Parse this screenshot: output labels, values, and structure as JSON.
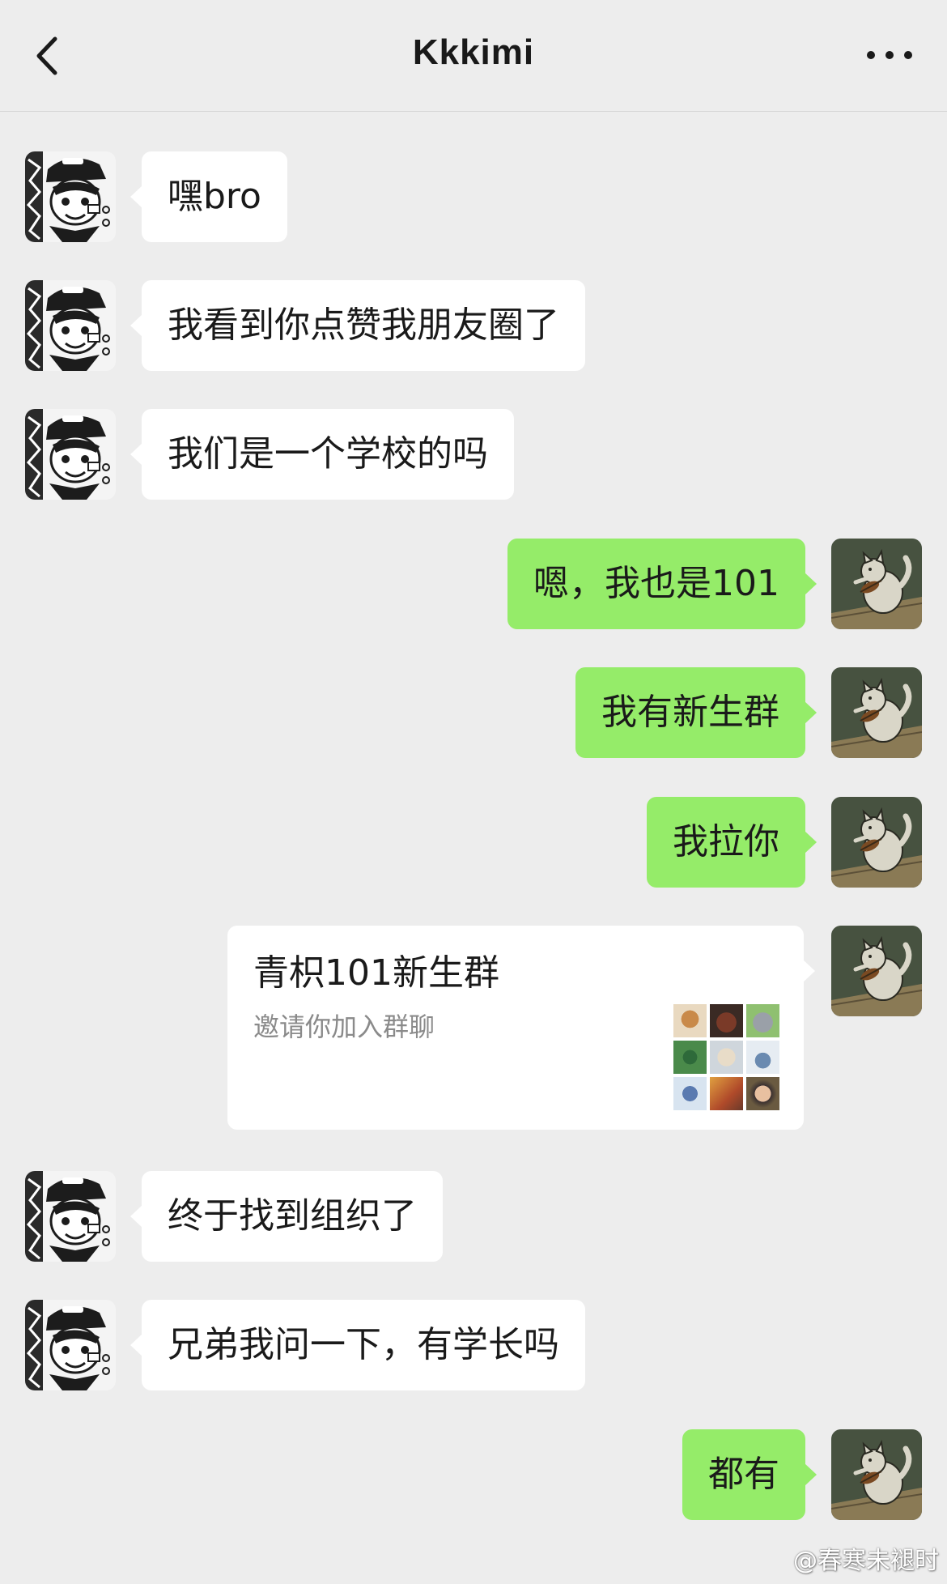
{
  "header": {
    "title": "Kkkimi",
    "back_icon": "chevron-left-icon",
    "more_icon": "more-dots-icon"
  },
  "messages": [
    {
      "side": "left",
      "text": "嘿bro"
    },
    {
      "side": "left",
      "text": "我看到你点赞我朋友圈了"
    },
    {
      "side": "left",
      "text": "我们是一个学校的吗"
    },
    {
      "side": "right",
      "text": "嗯，我也是101"
    },
    {
      "side": "right",
      "text": "我有新生群"
    },
    {
      "side": "right",
      "text": "我拉你"
    },
    {
      "side": "right",
      "type": "group_invite",
      "title": "青枳101新生群",
      "subtitle": "邀请你加入群聊"
    },
    {
      "side": "left",
      "text": "终于找到组织了"
    },
    {
      "side": "left",
      "text": "兄弟我问一下，有学长吗"
    },
    {
      "side": "right",
      "text": "都有"
    }
  ],
  "watermark": "@春寒未褪时",
  "colors": {
    "background": "#ededed",
    "incoming_bubble": "#ffffff",
    "outgoing_bubble": "#95ec69",
    "text": "#1a1a1a",
    "subtext": "#8a8a8a"
  }
}
